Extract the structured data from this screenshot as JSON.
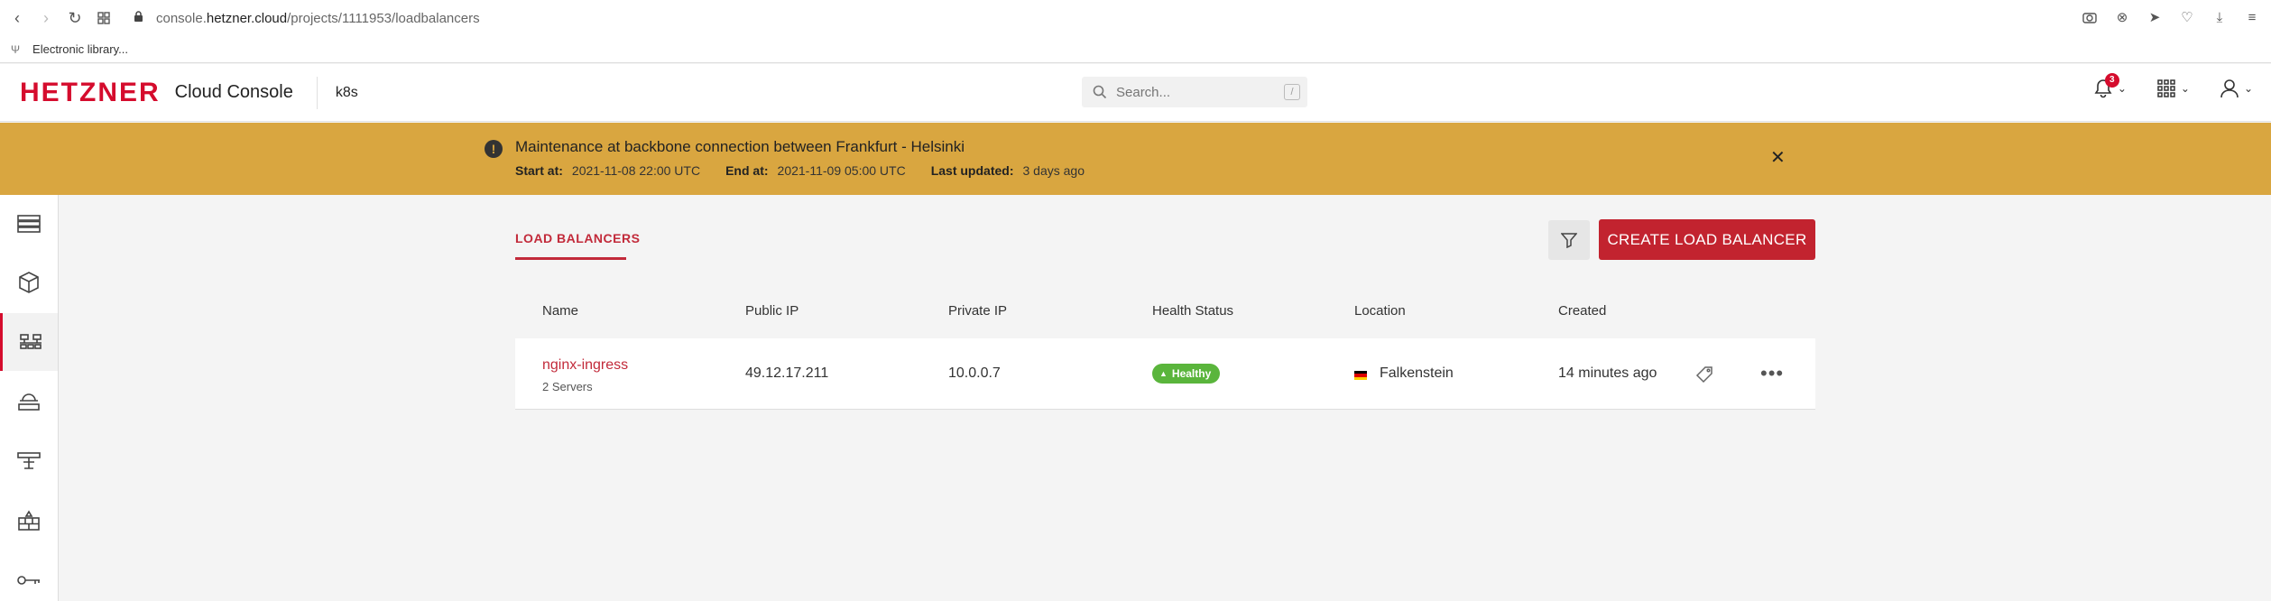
{
  "browser": {
    "url_prefix": "console.",
    "url_domain": "hetzner.cloud",
    "url_path": "/projects/1111953/loadbalancers",
    "bookmark": "Electronic library..."
  },
  "header": {
    "logo": "HETZNER",
    "brand": "Cloud Console",
    "project": "k8s",
    "search_placeholder": "Search...",
    "search_shortcut": "/",
    "notification_count": "3"
  },
  "banner": {
    "title": "Maintenance at backbone connection between Frankfurt - Helsinki",
    "start_label": "Start at:",
    "start_value": "2021-11-08 22:00 UTC",
    "end_label": "End at:",
    "end_value": "2021-11-09 05:00 UTC",
    "updated_label": "Last updated:",
    "updated_value": "3 days ago"
  },
  "main": {
    "tab": "LOAD BALANCERS",
    "create_button": "CREATE LOAD BALANCER",
    "columns": [
      "Name",
      "Public IP",
      "Private IP",
      "Health Status",
      "Location",
      "Created"
    ],
    "rows": [
      {
        "name": "nginx-ingress",
        "servers": "2 Servers",
        "public_ip": "49.12.17.211",
        "private_ip": "10.0.0.7",
        "health": "Healthy",
        "location": "Falkenstein",
        "created": "14 minutes ago"
      }
    ]
  },
  "colors": {
    "brand_red": "#d50c2d",
    "banner_yellow": "#d9a640",
    "healthy_green": "#5ab53c"
  },
  "icons": [
    "servers-icon",
    "volumes-icon",
    "load-balancers-icon",
    "floating-ips-icon",
    "networks-icon",
    "firewalls-icon",
    "security-icon"
  ]
}
